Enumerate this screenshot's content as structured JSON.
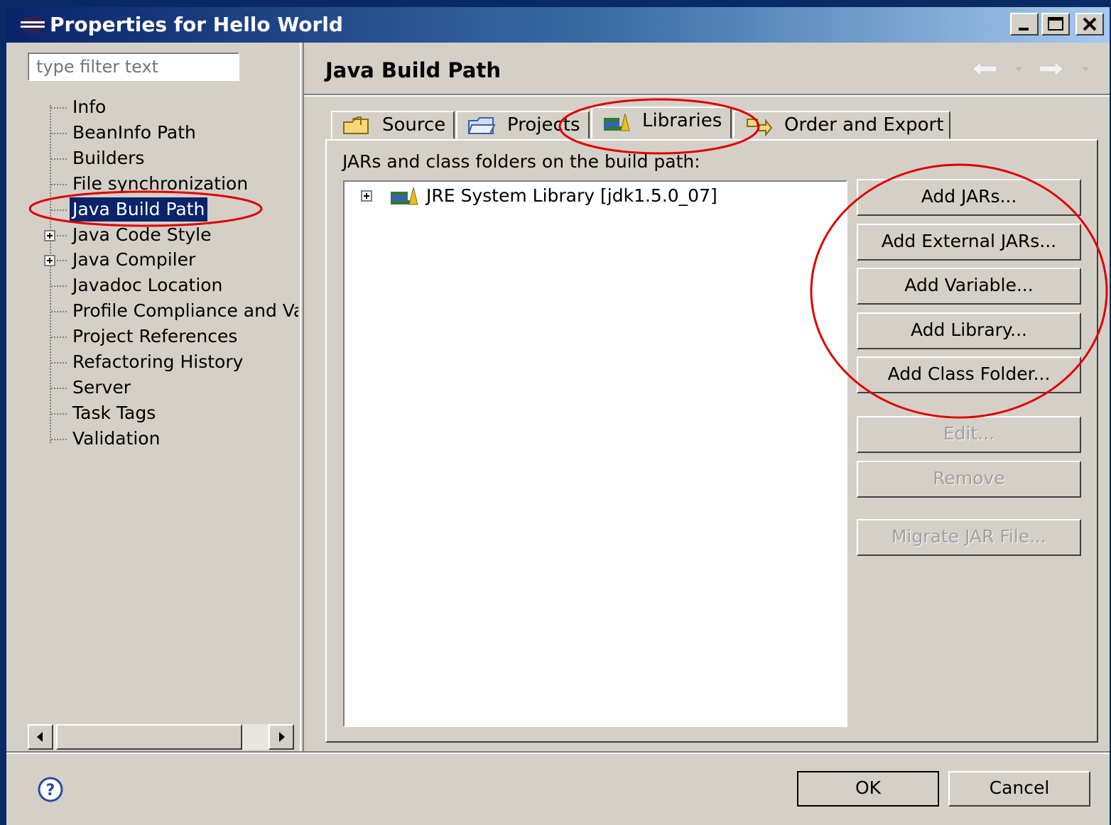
{
  "window": {
    "title": "Properties for Hello World",
    "controls": [
      "minimize",
      "maximize",
      "close"
    ]
  },
  "sidebar": {
    "filter_placeholder": "type filter text",
    "items": [
      {
        "label": "Info",
        "expandable": false
      },
      {
        "label": "BeanInfo Path",
        "expandable": false
      },
      {
        "label": "Builders",
        "expandable": false
      },
      {
        "label": "File synchronization",
        "expandable": false
      },
      {
        "label": "Java Build Path",
        "expandable": false,
        "selected": true
      },
      {
        "label": "Java Code Style",
        "expandable": true
      },
      {
        "label": "Java Compiler",
        "expandable": true
      },
      {
        "label": "Javadoc Location",
        "expandable": false
      },
      {
        "label": "Profile Compliance and Va",
        "expandable": false
      },
      {
        "label": "Project References",
        "expandable": false
      },
      {
        "label": "Refactoring History",
        "expandable": false
      },
      {
        "label": "Server",
        "expandable": false
      },
      {
        "label": "Task Tags",
        "expandable": false
      },
      {
        "label": "Validation",
        "expandable": false
      }
    ]
  },
  "main": {
    "page_title": "Java Build Path",
    "tabs": [
      {
        "label": "Source",
        "icon": "source-folder-icon"
      },
      {
        "label": "Projects",
        "icon": "projects-folder-icon"
      },
      {
        "label": "Libraries",
        "icon": "libraries-icon",
        "active": true
      },
      {
        "label": "Order and Export",
        "icon": "order-export-icon"
      }
    ],
    "content_label": "JARs and class folders on the build path:",
    "libraries": [
      {
        "label": "JRE System Library [jdk1.5.0_07]",
        "icon": "library-icon"
      }
    ],
    "buttons": [
      {
        "label": "Add JARs...",
        "enabled": true
      },
      {
        "label": "Add External JARs...",
        "enabled": true
      },
      {
        "label": "Add Variable...",
        "enabled": true
      },
      {
        "label": "Add Library...",
        "enabled": true
      },
      {
        "label": "Add Class Folder...",
        "enabled": true
      },
      {
        "label": "Edit...",
        "enabled": false
      },
      {
        "label": "Remove",
        "enabled": false
      },
      {
        "label": "Migrate JAR File...",
        "enabled": false
      }
    ]
  },
  "footer": {
    "ok_label": "OK",
    "cancel_label": "Cancel",
    "help_icon": "help-icon"
  },
  "colors": {
    "titlebar_start": "#0a246a",
    "titlebar_end": "#a6caf0",
    "dialog_bg": "#d4d0c8",
    "selection_bg": "#0a246a",
    "annotation": "#e00000"
  }
}
